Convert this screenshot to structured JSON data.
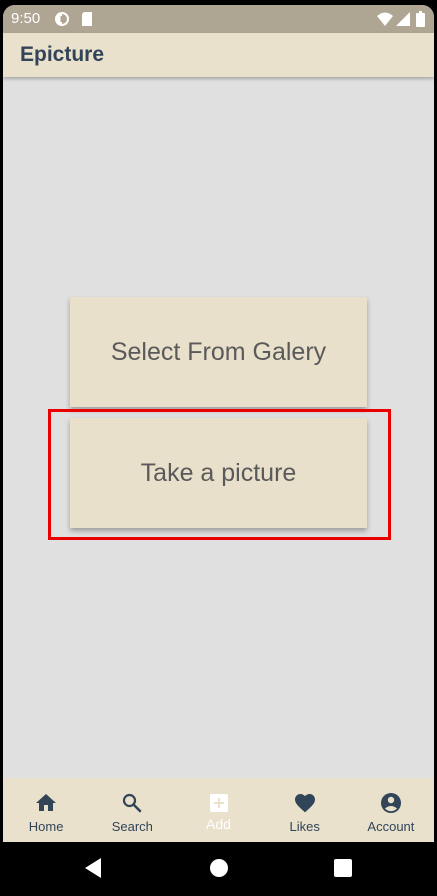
{
  "status_bar": {
    "time": "9:50",
    "background": "#afa593"
  },
  "app_bar": {
    "title": "Epicture",
    "background": "#e9e1cc",
    "title_color": "#314458"
  },
  "main": {
    "background": "#e0e0e0",
    "buttons": [
      {
        "label": "Select From Galery"
      },
      {
        "label": "Take a picture",
        "highlighted": true
      }
    ],
    "highlight_color": "#ea0000"
  },
  "bottom_nav": {
    "items": [
      {
        "label": "Home",
        "icon": "home-icon"
      },
      {
        "label": "Search",
        "icon": "search-icon"
      },
      {
        "label": "Add",
        "icon": "add-box-icon",
        "active": true
      },
      {
        "label": "Likes",
        "icon": "heart-icon"
      },
      {
        "label": "Account",
        "icon": "account-circle-icon"
      }
    ],
    "active_color": "#ffffff",
    "inactive_color": "#314458"
  },
  "system_nav": {
    "buttons": [
      "back-icon",
      "home-circle-icon",
      "recents-icon"
    ]
  }
}
